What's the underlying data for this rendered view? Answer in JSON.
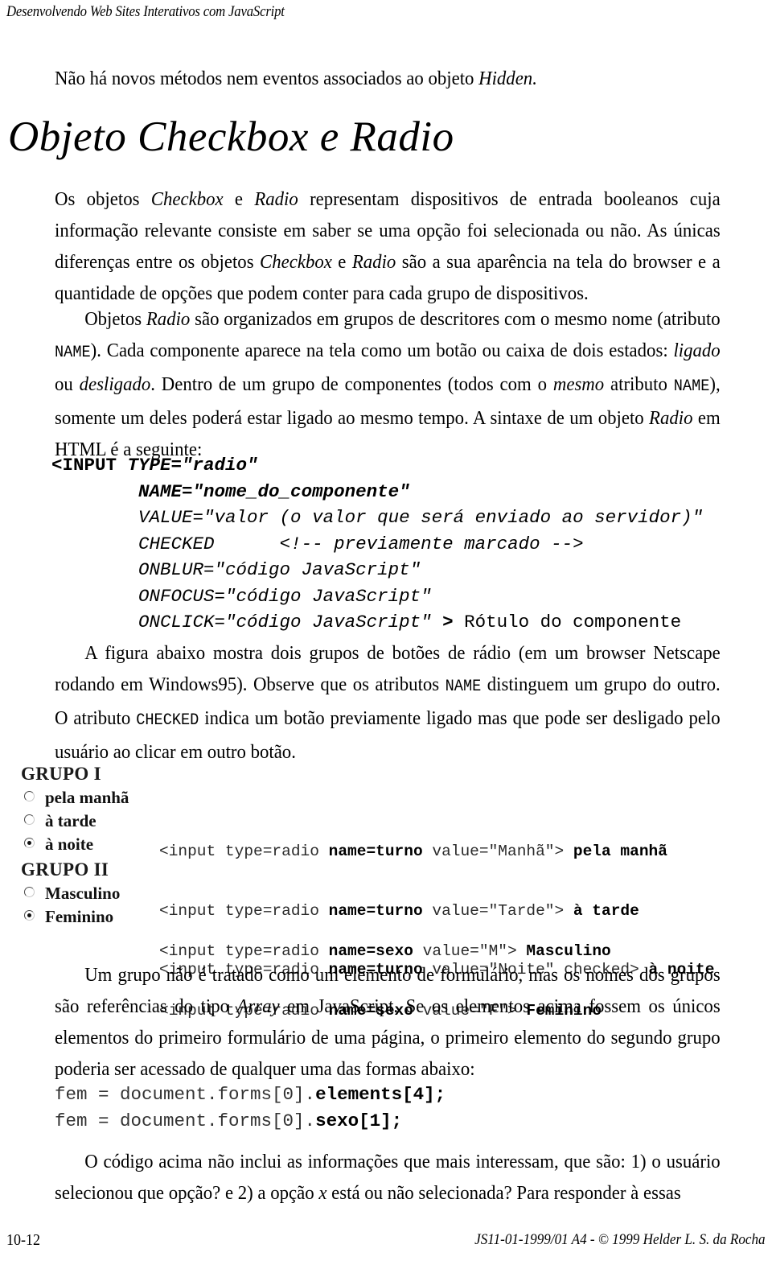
{
  "header": {
    "running_title": "Desenvolvendo Web Sites Interativos com JavaScript"
  },
  "intro": {
    "line_prefix": "Não há novos métodos nem eventos associados ao objeto ",
    "line_italic": "Hidden."
  },
  "heading": {
    "title": "Objeto Checkbox e Radio"
  },
  "paragraphs": {
    "p1_a": "Os objetos ",
    "p1_checkbox": "Checkbox",
    "p1_b": " e ",
    "p1_radio": "Radio",
    "p1_c": " representam dispositivos de entrada booleanos cuja informação relevante consiste em saber se uma opção foi selecionada ou não. As únicas diferenças entre os objetos ",
    "p1_checkbox2": "Checkbox",
    "p1_d": " e ",
    "p1_radio2": "Radio",
    "p1_e": " são a sua aparência na tela do browser e a quantidade de opções que podem conter para cada grupo de dispositivos.",
    "p2_a": "Objetos ",
    "p2_radio": "Radio",
    "p2_b": " são organizados em grupos de descritores com o mesmo nome (atributo ",
    "p2_name1": "NAME",
    "p2_c": "). Cada componente aparece na tela como um botão ou caixa de dois estados: ",
    "p2_ligado": "ligado",
    "p2_d": " ou ",
    "p2_desligado": "desligado",
    "p2_e": ". Dentro de um grupo de componentes (todos com o ",
    "p2_mesmo": "mesmo",
    "p2_f": " atributo ",
    "p2_name2": "NAME",
    "p2_g": "), somente um deles poderá estar ligado ao mesmo tempo. A sintaxe de um objeto ",
    "p2_radio2": "Radio",
    "p2_h": " em HTML é a seguinte:",
    "p3_a": "A figura abaixo mostra dois grupos de botões de rádio (em um browser Netscape rodando em Windows95). Observe que os atributos ",
    "p3_name": "NAME",
    "p3_b": " distinguem um grupo do outro. O atributo ",
    "p3_checked": "CHECKED",
    "p3_c": " indica um botão previamente ligado mas que pode ser desligado pelo usuário ao clicar em outro botão.",
    "p4_a": "Um grupo não é tratado como um elemento de formulário, mas os nomes dos grupos são referências do tipo ",
    "p4_array": "Array",
    "p4_b": " em JavaScript. Se os elementos acima fossem os únicos elementos do primeiro formulário de uma página, o primeiro elemento do segundo grupo poderia ser acessado de qualquer uma das formas abaixo:",
    "p5": "O código acima não inclui as informações que mais interessam, que são: 1) o usuário selecionou que opção? e 2) a opção ",
    "p5_x": "x",
    "p5_b": " está ou não selecionada? Para responder à essas"
  },
  "syntax_listing": {
    "l1_tag": "<INPUT ",
    "l1_attr": "TYPE=\"radio\"",
    "l2_attr": "NAME=\"nome_do_componente\"",
    "l3_attr": "VALUE=\"valor (o valor que será enviado ao servidor)\"",
    "l4_attr": "CHECKED",
    "l4_comment": "<!-- previamente marcado -->",
    "l5_attr": "ONBLUR=\"código JavaScript\"",
    "l6_attr": "ONFOCUS=\"código JavaScript\"",
    "l7_attr": "ONCLICK=\"código JavaScript\"",
    "l7_gt": " > ",
    "l7_label": "Rótulo do componente"
  },
  "figure": {
    "group1": {
      "title": "GRUPO I",
      "options": [
        {
          "label": "pela manhã",
          "checked": false
        },
        {
          "label": "à tarde",
          "checked": false
        },
        {
          "label": "à noite",
          "checked": true
        }
      ],
      "code": [
        {
          "pre": "<input type=radio ",
          "bold": "name=turno",
          "post": " value=\"Manhã\"> ",
          "boldend": "pela manhã"
        },
        {
          "pre": "<input type=radio ",
          "bold": "name=turno",
          "post": " value=\"Tarde\"> ",
          "boldend": "à tarde"
        },
        {
          "pre": "<input type=radio ",
          "bold": "name=turno",
          "post": " value=\"Noite\" checked> ",
          "boldend": "à noite"
        }
      ]
    },
    "group2": {
      "title": "GRUPO II",
      "options": [
        {
          "label": "Masculino",
          "checked": false
        },
        {
          "label": "Feminino",
          "checked": true
        }
      ],
      "code": [
        {
          "pre": "<input type=radio ",
          "bold": "name=sexo",
          "post": " value=\"M\"> ",
          "boldend": "Masculino"
        },
        {
          "pre": "<input type=radio ",
          "bold": "name=sexo",
          "post": " value=\"F\"> ",
          "boldend": "Feminino"
        }
      ]
    }
  },
  "code_sample": {
    "line1_pre": "fem = document.forms[0].",
    "line1_bold": "elements[4];",
    "line2_pre": "fem = document.forms[0].",
    "line2_bold": "sexo[1];"
  },
  "footer": {
    "page_number": "10-12",
    "credit": "JS11-01-1999/01 A4 - © 1999 Helder L. S. da Rocha"
  }
}
